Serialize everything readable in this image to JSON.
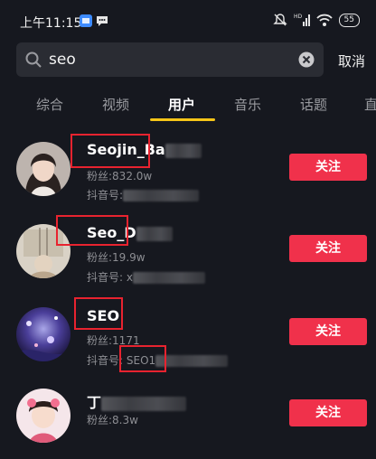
{
  "status_bar": {
    "time": "上午11:15",
    "battery": "55",
    "icons": [
      "app-icon",
      "chat-icon",
      "mute-icon",
      "hd-signal-icon",
      "wifi-icon",
      "battery-icon"
    ]
  },
  "search": {
    "query": "seo",
    "cancel_label": "取消"
  },
  "tabs": [
    {
      "label": "综合",
      "active": false
    },
    {
      "label": "视频",
      "active": false
    },
    {
      "label": "用户",
      "active": true
    },
    {
      "label": "音乐",
      "active": false
    },
    {
      "label": "话题",
      "active": false
    },
    {
      "label": "直",
      "active": false
    }
  ],
  "results": [
    {
      "name": "Seojin_Ba",
      "line1": "粉丝:832.0w",
      "line2": "抖音号:",
      "follow_label": "关注"
    },
    {
      "name": "Seo_D",
      "line1": "粉丝:19.9w",
      "line2": "抖音号: x",
      "follow_label": "关注"
    },
    {
      "name": "SEO",
      "line1": "粉丝:1171",
      "line2_prefix": "抖音号",
      "line2_id": ": SEO1",
      "follow_label": "关注"
    },
    {
      "name": "丁",
      "line1": "粉丝:8.3w",
      "follow_label": "关注"
    }
  ],
  "colors": {
    "background": "#16181f",
    "accent_yellow": "#f5c518",
    "follow_red": "#f0314b",
    "highlight_box": "#e8232f"
  }
}
